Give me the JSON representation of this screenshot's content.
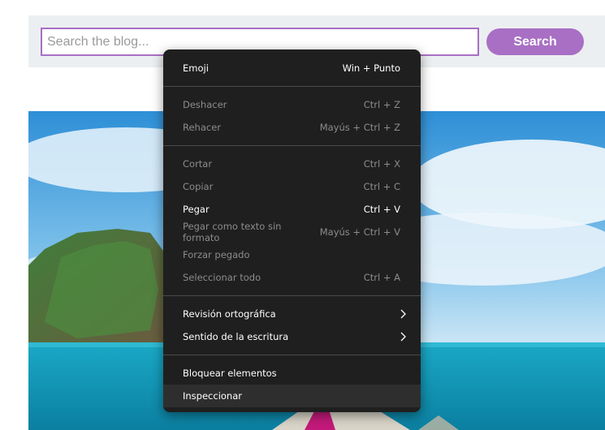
{
  "search": {
    "placeholder": "Search the blog...",
    "button_label": "Search"
  },
  "hero": {
    "image": "tropical-sea-island-boat-photo"
  },
  "context_menu": {
    "items": [
      {
        "label": "Emoji",
        "shortcut": "Win + Punto",
        "enabled": true
      },
      {
        "label": "Deshacer",
        "shortcut": "Ctrl + Z",
        "enabled": false
      },
      {
        "label": "Rehacer",
        "shortcut": "Mayús + Ctrl + Z",
        "enabled": false
      },
      {
        "label": "Cortar",
        "shortcut": "Ctrl + X",
        "enabled": false
      },
      {
        "label": "Copiar",
        "shortcut": "Ctrl + C",
        "enabled": false
      },
      {
        "label": "Pegar",
        "shortcut": "Ctrl + V",
        "enabled": true
      },
      {
        "label": "Pegar como texto sin formato",
        "shortcut": "Mayús + Ctrl + V",
        "enabled": false
      },
      {
        "label": "Forzar pegado",
        "shortcut": "",
        "enabled": false
      },
      {
        "label": "Seleccionar todo",
        "shortcut": "Ctrl + A",
        "enabled": false
      },
      {
        "label": "Revisión ortográfica",
        "submenu": true,
        "enabled": true
      },
      {
        "label": "Sentido de la escritura",
        "submenu": true,
        "enabled": true
      },
      {
        "label": "Bloquear elementos",
        "enabled": true
      },
      {
        "label": "Inspeccionar",
        "enabled": true,
        "hovered": true
      }
    ]
  },
  "colors": {
    "accent": "#a86fc4",
    "search_bar_bg": "#eceff1",
    "menu_bg": "#1f1f1f",
    "menu_text": "#ffffff",
    "menu_disabled_text": "#8c8c8c",
    "menu_hover_bg": "#2e2e2e"
  }
}
